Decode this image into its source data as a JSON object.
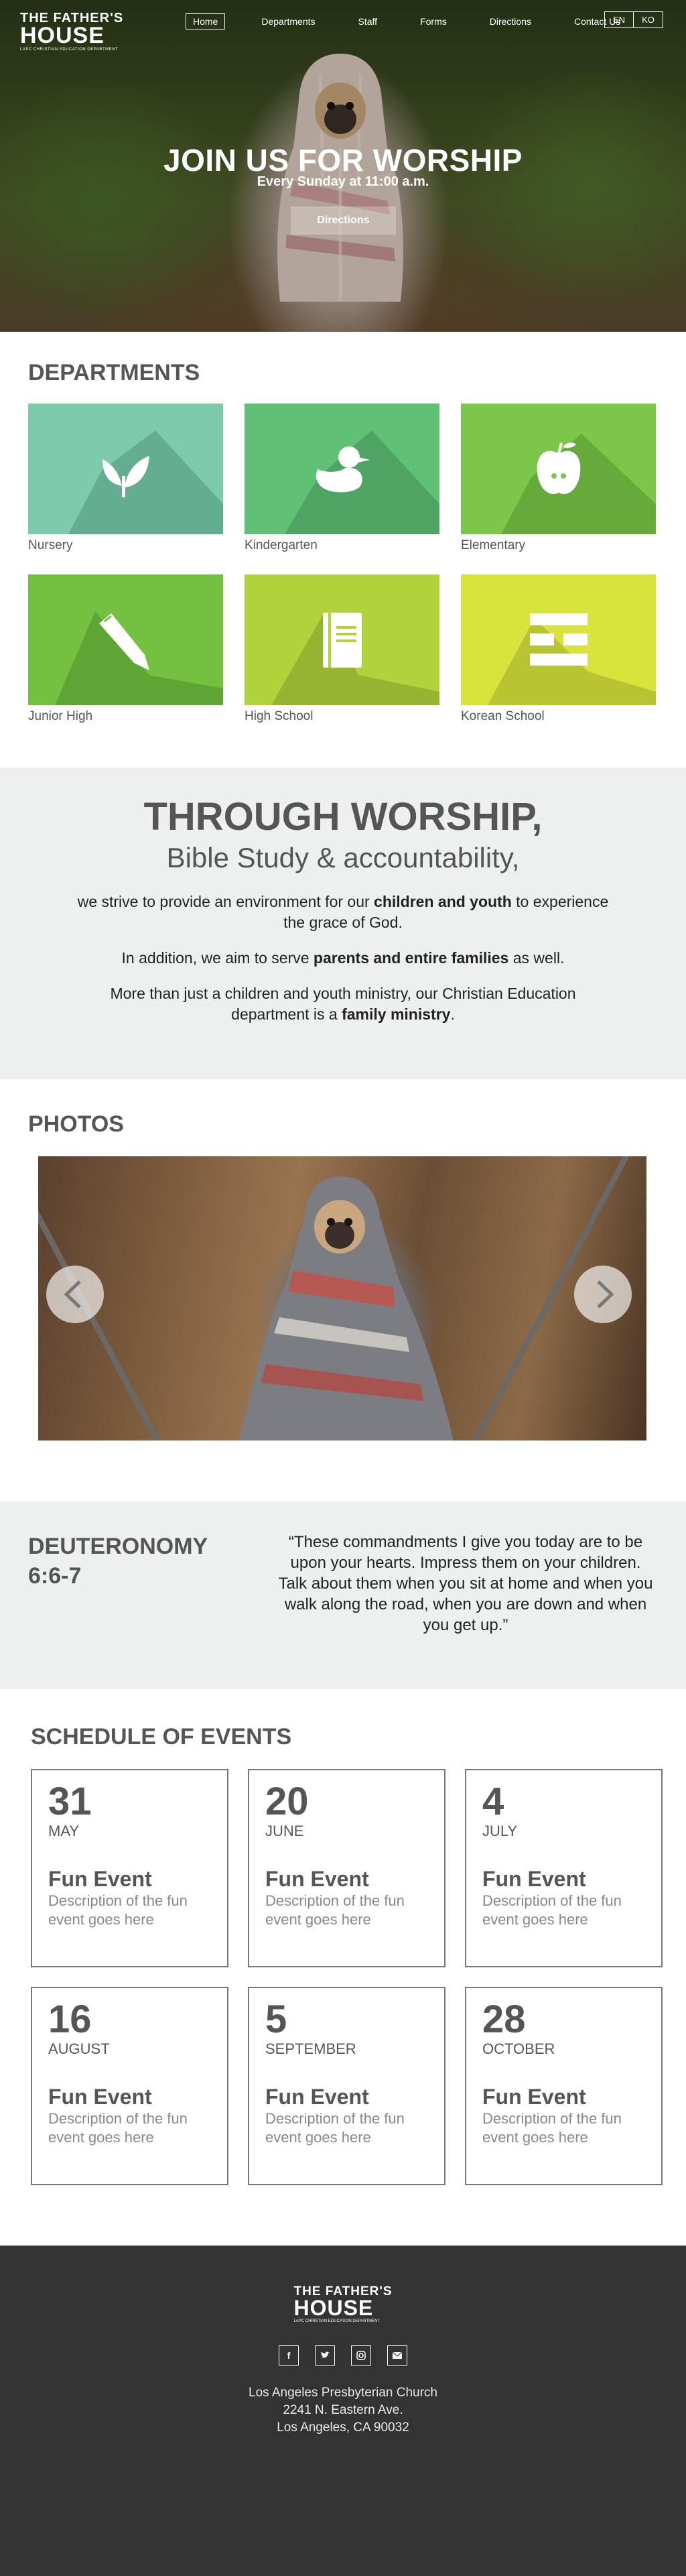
{
  "brand": {
    "line1": "THE FATHER'S",
    "line2": "HOUSE",
    "tagline": "LAPC CHRISTIAN EDUCATION DEPARTMENT"
  },
  "nav": {
    "items": [
      "Home",
      "Departments",
      "Staff",
      "Forms",
      "Directions",
      "Contact Us"
    ],
    "active": "Home"
  },
  "lang": {
    "en": "EN",
    "ko": "KO"
  },
  "hero": {
    "title": "JOIN US FOR WORSHIP",
    "subtitle": "Every Sunday at 11:00 a.m.",
    "button": "Directions"
  },
  "departments": {
    "title": "DEPARTMENTS",
    "items": [
      {
        "label": "Nursery",
        "icon": "leaf-icon",
        "color": "#7dcbac",
        "shadow": "#64ad90"
      },
      {
        "label": "Kindergarten",
        "icon": "duck-icon",
        "color": "#60c076",
        "shadow": "#4fa463"
      },
      {
        "label": "Elementary",
        "icon": "apple-icon",
        "color": "#7cc64a",
        "shadow": "#67aa3c"
      },
      {
        "label": "Junior High",
        "icon": "pencil-icon",
        "color": "#74c142",
        "shadow": "#5fa535"
      },
      {
        "label": "High School",
        "icon": "book-icon",
        "color": "#b0d33b",
        "shadow": "#95b431"
      },
      {
        "label": "Korean School",
        "icon": "korean-char-icon",
        "color": "#d8e33c",
        "shadow": "#b9c432"
      }
    ]
  },
  "worship": {
    "title": "THROUGH WORSHIP,",
    "subtitle": "Bible Study & accountability,",
    "p1_pre": "we strive to provide an environment for our ",
    "p1_bold": "children and youth",
    "p1_post": " to experience the grace of God.",
    "p2_pre": "In addition, we aim to serve ",
    "p2_bold": "parents and entire families",
    "p2_post": " as well.",
    "p3_pre": "More than just a children and youth ministry, our Christian Education department is a ",
    "p3_bold": "family ministry",
    "p3_post": "."
  },
  "photos": {
    "title": "PHOTOS"
  },
  "verse": {
    "reference": "DEUTERONOMY 6:6-7",
    "text": "“These commandments I give you today are to be upon your hearts. Impress them on your children. Talk about them when you sit at home and when you walk along the  road, when you are down and when you get up.”"
  },
  "schedule": {
    "title": "SCHEDULE OF EVENTS",
    "events": [
      {
        "day": "31",
        "month": "MAY",
        "title": "Fun Event",
        "desc": "Description of the fun event goes here"
      },
      {
        "day": "20",
        "month": "JUNE",
        "title": "Fun Event",
        "desc": "Description of the fun event goes here"
      },
      {
        "day": "4",
        "month": "JULY",
        "title": "Fun Event",
        "desc": "Description of the fun event goes here"
      },
      {
        "day": "16",
        "month": "AUGUST",
        "title": "Fun Event",
        "desc": "Description of the fun event goes here"
      },
      {
        "day": "5",
        "month": "SEPTEMBER",
        "title": "Fun Event",
        "desc": "Description of the fun event goes here"
      },
      {
        "day": "28",
        "month": "OCTOBER",
        "title": "Fun Event",
        "desc": "Description of the fun event goes here"
      }
    ]
  },
  "footer": {
    "social": [
      "facebook-icon",
      "twitter-icon",
      "instagram-icon",
      "email-icon"
    ],
    "address_line1": "Los Angeles Presbyterian Church",
    "address_line2": "2241 N. Eastern Ave.",
    "address_line3": "Los Angeles, CA 90032"
  }
}
